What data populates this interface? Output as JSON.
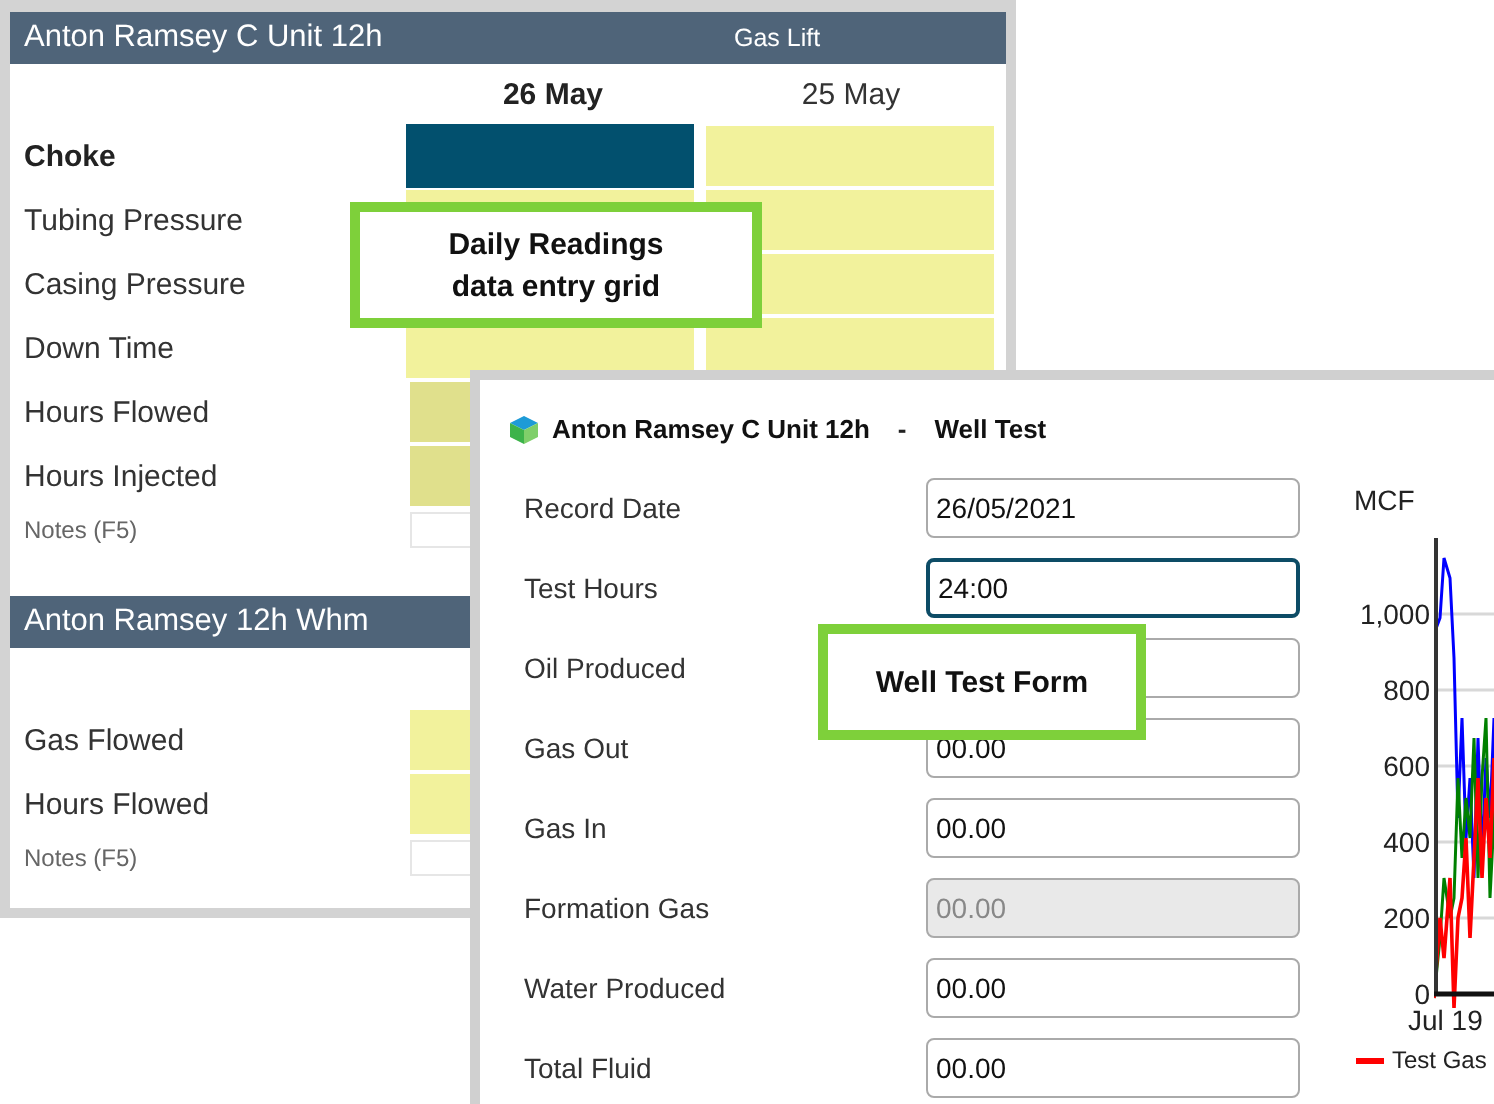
{
  "grid_panel": {
    "sections": [
      {
        "title": "Anton Ramsey C Unit 12h",
        "subtitle": "Gas Lift",
        "columns": [
          {
            "label": "26 May",
            "selected": true
          },
          {
            "label": "25 May",
            "selected": false
          }
        ],
        "rows": [
          {
            "label": "Choke",
            "kind": "reading",
            "selected": true,
            "cells": [
              {
                "kind": "active"
              },
              {
                "kind": "input"
              }
            ]
          },
          {
            "label": "Tubing Pressure",
            "kind": "reading",
            "selected": false,
            "cells": [
              {
                "kind": "input"
              },
              {
                "kind": "input"
              }
            ]
          },
          {
            "label": "Casing Pressure",
            "kind": "reading",
            "selected": false,
            "cells": [
              {
                "kind": "covered"
              },
              {
                "kind": "input"
              }
            ]
          },
          {
            "label": "Down Time",
            "kind": "reading",
            "selected": false,
            "cells": [
              {
                "kind": "input"
              },
              {
                "kind": "input"
              }
            ]
          },
          {
            "label": "Hours Flowed",
            "kind": "reading",
            "selected": false,
            "cells": [
              {
                "kind": "calculated"
              }
            ]
          },
          {
            "label": "Hours Injected",
            "kind": "reading",
            "selected": false,
            "cells": [
              {
                "kind": "calculated"
              }
            ]
          },
          {
            "label": "Notes (F5)",
            "kind": "notes",
            "selected": false,
            "cells": [
              {
                "kind": "notes"
              }
            ]
          }
        ]
      },
      {
        "title": "Anton Ramsey 12h Whm",
        "rows": [
          {
            "label": "Gas Flowed",
            "kind": "reading",
            "selected": false,
            "cells": [
              {
                "kind": "input"
              }
            ]
          },
          {
            "label": "Hours Flowed",
            "kind": "reading",
            "selected": false,
            "cells": [
              {
                "kind": "input"
              }
            ]
          },
          {
            "label": "Notes (F5)",
            "kind": "notes",
            "selected": false,
            "cells": [
              {
                "kind": "notes"
              }
            ]
          }
        ]
      }
    ]
  },
  "well_test": {
    "title": "Anton Ramsey C Unit 12h",
    "separator": "-",
    "form_name": "Well Test",
    "fields": [
      {
        "label": "Record Date",
        "value": "26/05/2021",
        "focused": false,
        "disabled": false
      },
      {
        "label": "Test Hours",
        "value": "24:00",
        "focused": true,
        "disabled": false
      },
      {
        "label": "Oil Produced",
        "focused": false,
        "disabled": false
      },
      {
        "label": "Gas Out",
        "value": "00.00",
        "focused": false,
        "disabled": false
      },
      {
        "label": "Gas In",
        "value": "00.00",
        "focused": false,
        "disabled": false
      },
      {
        "label": "Formation Gas",
        "value": "00.00",
        "focused": false,
        "disabled": true
      },
      {
        "label": "Water Produced",
        "value": "00.00",
        "focused": false,
        "disabled": false
      },
      {
        "label": "Total Fluid",
        "value": "00.00",
        "focused": false,
        "disabled": false
      }
    ],
    "chart": {
      "unit": "MCF",
      "y_ticks": [
        "1,000",
        "800",
        "600",
        "400",
        "200",
        "0"
      ],
      "x_tick": "Jul 19",
      "legend": [
        {
          "name": "Test Gas",
          "color": "#ff0000"
        }
      ]
    }
  },
  "callouts": [
    {
      "text": "Daily Readings\ndata entry grid"
    },
    {
      "text": "Well Test Form"
    }
  ]
}
